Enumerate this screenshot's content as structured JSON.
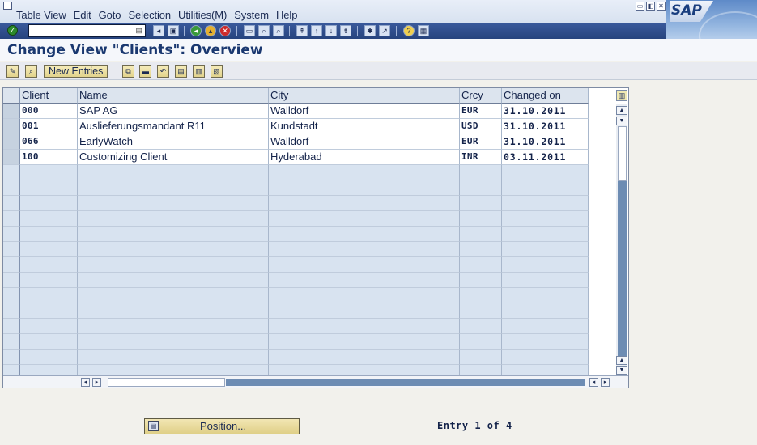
{
  "menu": [
    "Table View",
    "Edit",
    "Goto",
    "Selection",
    "Utilities(M)",
    "System",
    "Help"
  ],
  "window_buttons": [
    "▭",
    "◧",
    "✕"
  ],
  "logo_text": "SAP",
  "command_field": {
    "value": ""
  },
  "std_toolbar_icons": [
    "back-icon",
    "save-icon",
    "green-back-icon",
    "exit-icon",
    "cancel-icon",
    "print-icon",
    "find-icon",
    "find-next-icon",
    "first-page-icon",
    "prev-page-icon",
    "next-page-icon",
    "last-page-icon",
    "create-session-icon",
    "shortcut-icon",
    "help-icon",
    "layout-icon"
  ],
  "page_title": "Change View \"Clients\": Overview",
  "app_toolbar": {
    "new_entries_label": "New Entries"
  },
  "table": {
    "columns": [
      "Client",
      "Name",
      "City",
      "Crcy",
      "Changed on"
    ],
    "rows": [
      {
        "client": "000",
        "name": "SAP AG",
        "city": "Walldorf",
        "crcy": "EUR",
        "changed_on": "31.10.2011"
      },
      {
        "client": "001",
        "name": "Auslieferungsmandant R11",
        "city": "Kundstadt",
        "crcy": "USD",
        "changed_on": "31.10.2011"
      },
      {
        "client": "066",
        "name": "EarlyWatch",
        "city": "Walldorf",
        "crcy": "EUR",
        "changed_on": "31.10.2011"
      },
      {
        "client": "100",
        "name": "Customizing Client",
        "city": "Hyderabad",
        "crcy": "INR",
        "changed_on": "03.11.2011"
      }
    ]
  },
  "footer": {
    "position_label": "Position...",
    "entry_info": "Entry 1 of 4"
  },
  "colors": {
    "header_bg": "#dce4ee",
    "empty_row_bg": "#d8e3f0",
    "toolbar_bg": "#27447e",
    "button_bg": "#e2d38c",
    "title_color": "#1a3870"
  }
}
